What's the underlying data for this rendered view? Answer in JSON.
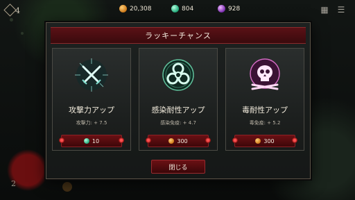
{
  "hud": {
    "level": "4",
    "resources": [
      {
        "icon": "gold-coin-icon",
        "value": "20,308"
      },
      {
        "icon": "gem-icon",
        "value": "804"
      },
      {
        "icon": "purple-orb-icon",
        "value": "928"
      }
    ],
    "bottom_left_number": "2"
  },
  "modal": {
    "title": "ラッキーチャンス",
    "close_label": "閉じる",
    "cards": [
      {
        "title": "攻撃力アップ",
        "stat": "攻撃力: + 7.5",
        "price": "10",
        "currency": "gem-icon",
        "icon": "crossed-swords-icon",
        "accent": "#7fe0d0"
      },
      {
        "title": "感染耐性アップ",
        "stat": "感染免疫: + 4.7",
        "price": "300",
        "currency": "gold-coin-icon",
        "icon": "biohazard-icon",
        "accent": "#6fe0b0"
      },
      {
        "title": "毒耐性アップ",
        "stat": "毒免疫: + 5.2",
        "price": "300",
        "currency": "gold-coin-icon",
        "icon": "skull-crossbones-icon",
        "accent": "#f08ad8"
      }
    ]
  }
}
